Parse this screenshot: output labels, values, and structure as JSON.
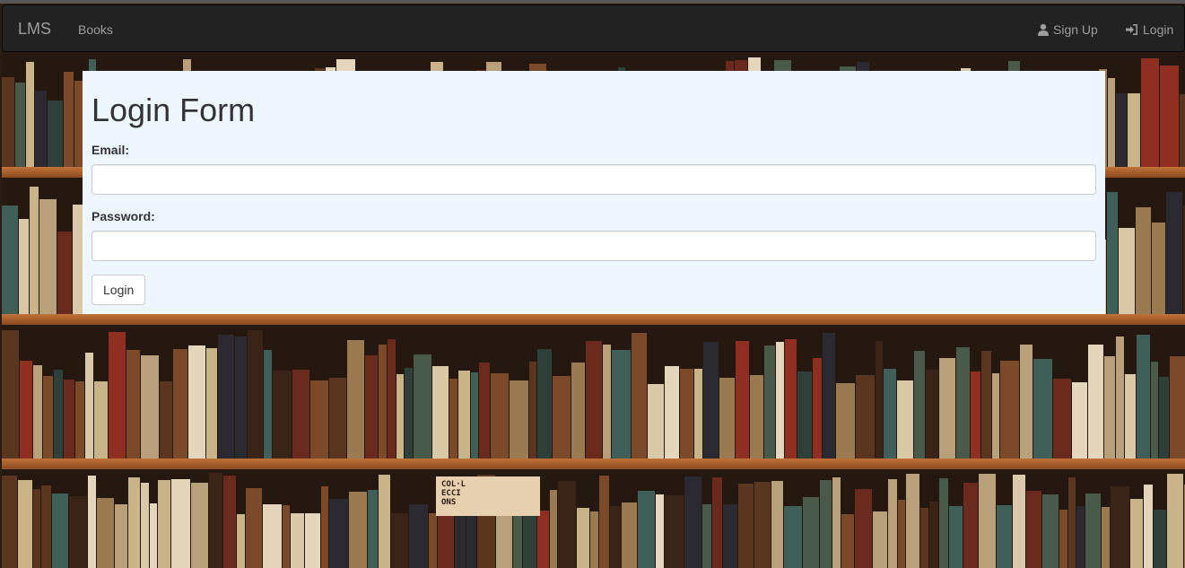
{
  "navbar": {
    "brand": "LMS",
    "books": "Books",
    "signup": "Sign Up",
    "login": "Login"
  },
  "form": {
    "title": "Login Form",
    "email_label": "Email:",
    "email_value": "",
    "password_label": "Password:",
    "password_value": "",
    "submit": "Login"
  },
  "background": {
    "book_spine_text": [
      "COL·L",
      "ECCI",
      "ONS"
    ]
  },
  "colors": {
    "navbar_bg": "#222222",
    "nav_text": "#9d9d9d",
    "panel_bg": "#eef6ff",
    "shelf": "#c1733a"
  },
  "icons": {
    "signup": "user-icon",
    "login": "log-in-icon"
  }
}
